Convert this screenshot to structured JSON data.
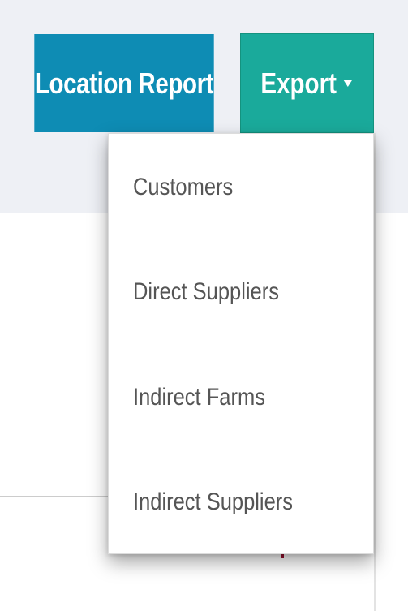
{
  "toolbar": {
    "location_report_label": "Location Report",
    "export_label": "Export"
  },
  "export_menu": {
    "items": [
      {
        "label": "Customers"
      },
      {
        "label": "Direct Suppliers"
      },
      {
        "label": "Indirect Farms"
      },
      {
        "label": "Indirect Suppliers"
      }
    ]
  },
  "icons": {
    "export_caret": "caret-down-icon"
  },
  "colors": {
    "location_report_bg": "#0e8cb4",
    "export_bg": "#1aaa9b",
    "menu_text": "#555555",
    "top_band_bg": "#eef0f5"
  }
}
